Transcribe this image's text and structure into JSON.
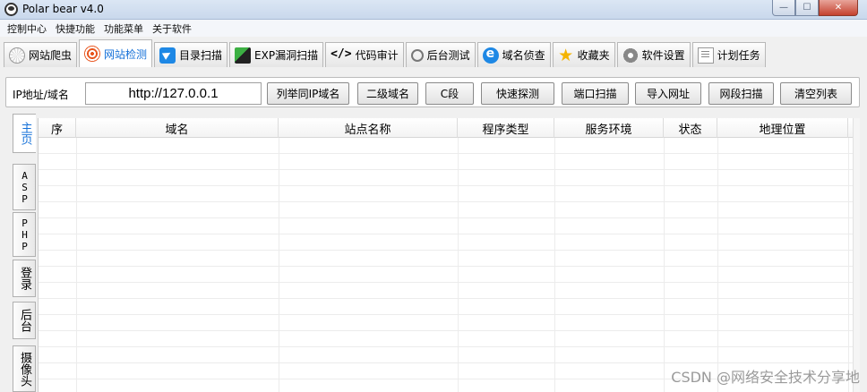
{
  "window": {
    "title": "Polar bear v4.0",
    "min_glyph": "—",
    "max_glyph": "☐",
    "close_glyph": "✕"
  },
  "menu": [
    "控制中心",
    "快捷功能",
    "功能菜单",
    "关于软件"
  ],
  "tabs": [
    {
      "label": "网站爬虫",
      "icon": "spider-web-icon",
      "active": false
    },
    {
      "label": "网站检测",
      "icon": "target-icon",
      "active": true
    },
    {
      "label": "目录扫描",
      "icon": "send-icon",
      "active": false
    },
    {
      "label": "EXP漏洞扫描",
      "icon": "exploit-icon",
      "active": false
    },
    {
      "label": "代码审计",
      "icon": "code-icon",
      "active": false
    },
    {
      "label": "后台测试",
      "icon": "key-icon",
      "active": false
    },
    {
      "label": "域名侦查",
      "icon": "ie-icon",
      "active": false
    },
    {
      "label": "收藏夹",
      "icon": "star-icon",
      "active": false
    },
    {
      "label": "软件设置",
      "icon": "gear-icon",
      "active": false
    },
    {
      "label": "计划任务",
      "icon": "task-icon",
      "active": false
    }
  ],
  "toolbar": {
    "ip_label": "IP地址/域名",
    "ip_value": "http://127.0.0.1",
    "buttons": [
      "列举同IP域名",
      "二级域名",
      "C段",
      "快速探测",
      "端口扫描",
      "导入网址",
      "网段扫描",
      "清空列表"
    ]
  },
  "side_tabs": [
    "主页",
    "ASP",
    "PHP",
    "登录",
    "后台",
    "摄像头"
  ],
  "grid": {
    "columns": [
      "序",
      "域名",
      "站点名称",
      "程序类型",
      "服务环境",
      "状态",
      "地理位置"
    ]
  },
  "watermark": "CSDN @网络安全技术分享地"
}
